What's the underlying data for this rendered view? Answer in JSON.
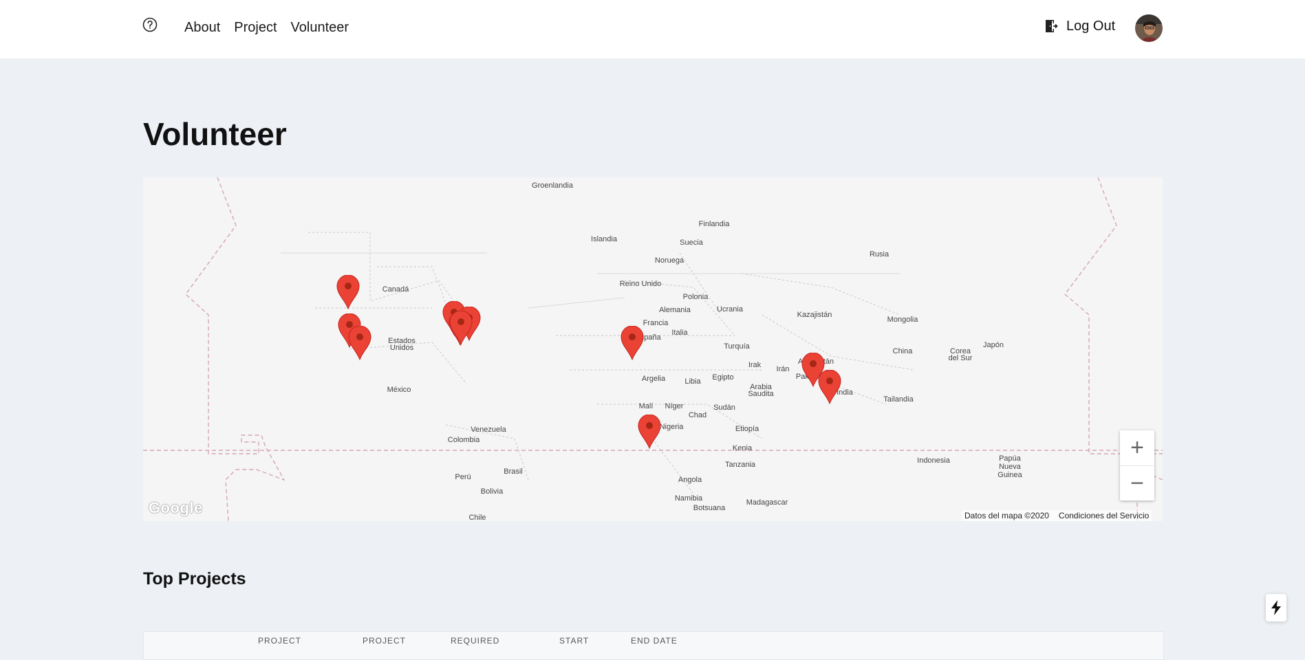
{
  "nav": {
    "items": [
      "About",
      "Project",
      "Volunteer"
    ],
    "logout_label": "Log Out"
  },
  "page": {
    "title": "Volunteer"
  },
  "map": {
    "labels": {
      "groenlandia": "Groenlandia",
      "islandia": "Islandia",
      "finlandia": "Finlandia",
      "suecia": "Suecia",
      "noruega": "Noruega",
      "rusia": "Rusia",
      "canada": "Canadá",
      "reino_unido": "Reino Unido",
      "polonia": "Polonia",
      "alemania": "Alemania",
      "ucrania": "Ucrania",
      "kazajistan": "Kazajistán",
      "mongolia": "Mongolia",
      "francia": "Francia",
      "espana": "España",
      "italia": "Italia",
      "estados": "Estados",
      "unidos": "Unidos",
      "turquia": "Turquía",
      "china": "China",
      "corea": "Corea",
      "del_sur": "del Sur",
      "japon": "Japón",
      "irak": "Irak",
      "iran": "Irán",
      "afganistan": "Afganistán",
      "pakistan": "Pakistán",
      "mexico": "México",
      "argelia": "Argelia",
      "libia": "Libia",
      "egipto": "Egipto",
      "arabia": "Arabia",
      "saudita": "Saudita",
      "india": "India",
      "tailandia": "Tailandia",
      "mali": "Malí",
      "niger": "Níger",
      "chad": "Chad",
      "sudan": "Sudán",
      "venezuela": "Venezuela",
      "colombia": "Colombia",
      "nigeria": "Nigeria",
      "etiopia": "Etiopía",
      "kenia": "Kenia",
      "indonesia": "Indonesia",
      "papua": "Papúa",
      "nueva": "Nueva",
      "guinea": "Guinea",
      "tanzania": "Tanzania",
      "peru": "Perú",
      "brasil": "Brasil",
      "bolivia": "Bolivia",
      "angola": "Angola",
      "namibia": "Namibia",
      "botsuana": "Botsuana",
      "madagascar": "Madagascar",
      "chile": "Chile"
    },
    "logo": "Google",
    "attribution_data": "Datos del mapa ©2020",
    "attribution_terms": "Condiciones del Servicio",
    "zoom_in": "+",
    "zoom_out": "−",
    "pin_color": "#ea4335",
    "pin_dot_color": "#a52714"
  },
  "top_projects": {
    "title": "Top Projects",
    "columns": [
      "PROJECT",
      "PROJECT",
      "REQUIRED",
      "START",
      "END DATE"
    ]
  },
  "icons": {
    "help": "help-circle-icon",
    "logout": "logout-door-icon",
    "flash": "lightning-icon"
  }
}
